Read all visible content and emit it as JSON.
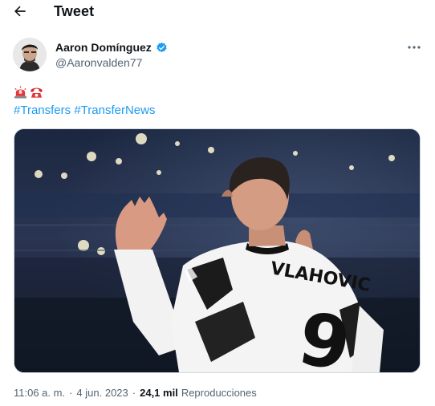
{
  "header": {
    "title": "Tweet",
    "back_icon": "arrow-left-icon"
  },
  "tweet": {
    "author": {
      "name": "Aaron Domínguez",
      "handle": "@Aaronvalden77",
      "verified": true,
      "verified_color": "#1d9bf0"
    },
    "emojis": [
      "rotating-light-icon",
      "telephone-icon"
    ],
    "hashtags": [
      "#Transfers",
      "#TransferNews"
    ],
    "image": {
      "jersey_name": "VLAHOVIC",
      "jersey_number": "9"
    },
    "meta": {
      "time": "11:06 a. m.",
      "separator": "·",
      "date": "4 jun. 2023",
      "views_count": "24,1 mil",
      "views_label": "Reproducciones"
    }
  },
  "colors": {
    "link": "#1d9bf0",
    "text": "#0f1419",
    "secondary": "#536471"
  }
}
